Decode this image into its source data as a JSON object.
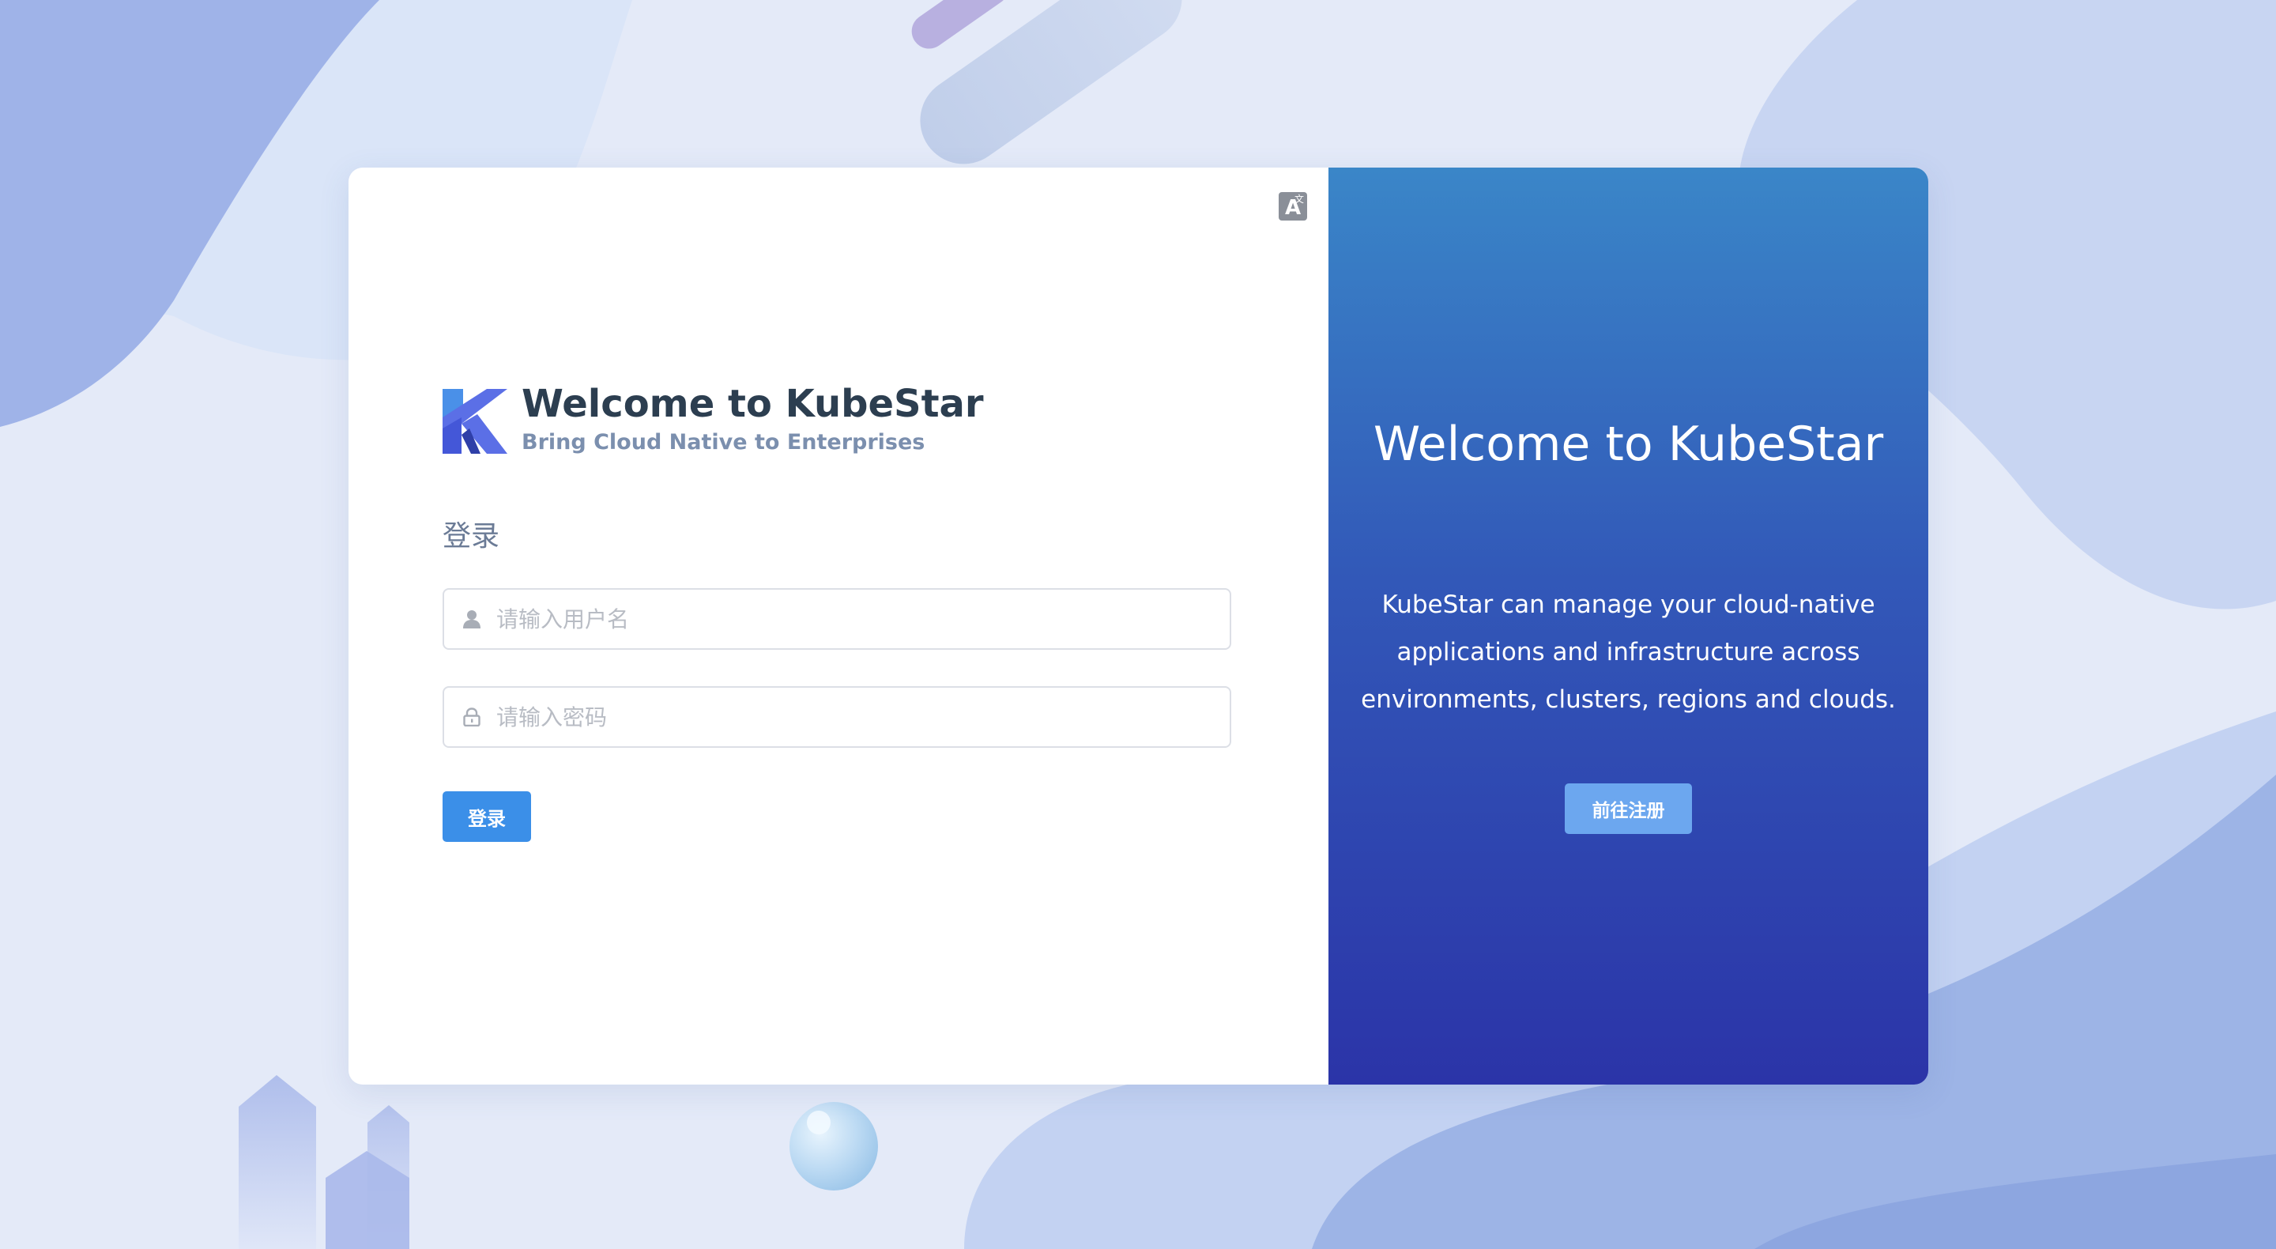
{
  "language_toggle": {
    "glyph": "A",
    "superscript": "文"
  },
  "brand": {
    "title": "Welcome to KubeStar",
    "subtitle": "Bring Cloud Native to Enterprises"
  },
  "login_form": {
    "title": "登录",
    "username_placeholder": "请输入用户名",
    "username_value": "",
    "password_placeholder": "请输入密码",
    "password_value": "",
    "submit_label": "登录"
  },
  "promo": {
    "title": "Welcome to KubeStar",
    "description_lines": [
      "KubeStar can manage your cloud-native",
      "applications and infrastructure across",
      "environments, clusters, regions and clouds."
    ],
    "register_label": "前往注册"
  },
  "colors": {
    "primary": "#3b8fe8",
    "promo_gradient_top": "#3a86c8",
    "promo_gradient_bottom": "#2b34a8",
    "page_background": "#e4eaf8"
  },
  "icons": {
    "logo": "kubestar-logo-icon",
    "user": "user-icon",
    "lock": "lock-icon",
    "language": "translate-icon"
  }
}
